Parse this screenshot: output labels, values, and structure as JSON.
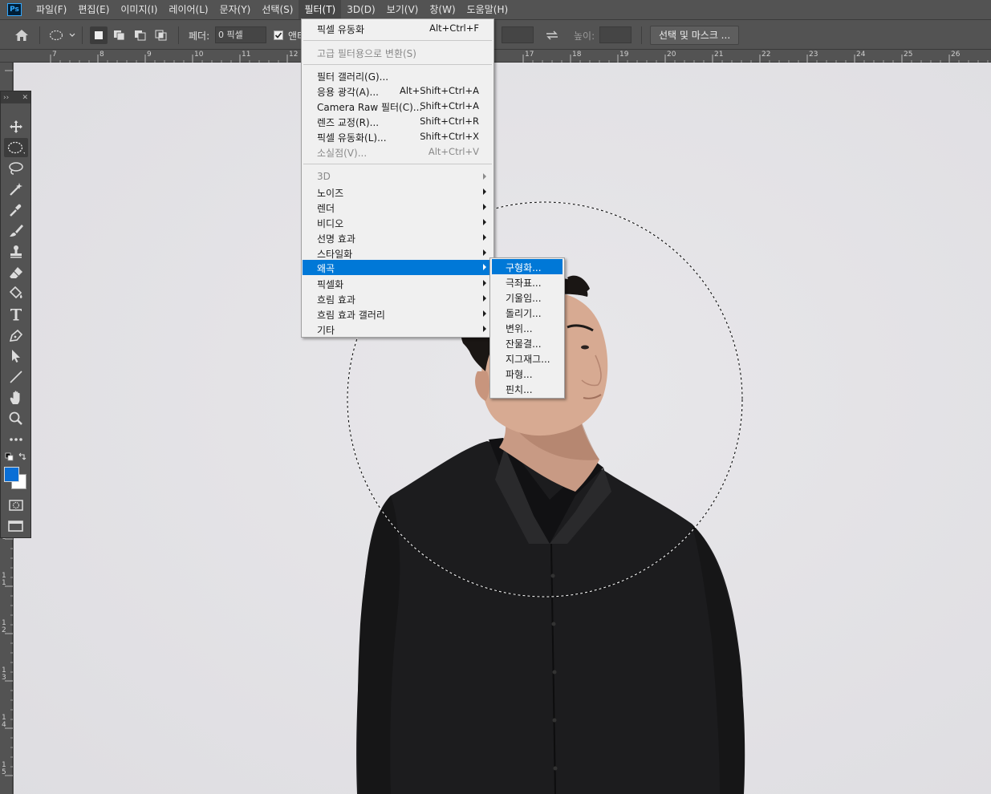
{
  "app": {
    "logo_text": "Ps"
  },
  "menubar": {
    "items": [
      "파일(F)",
      "편집(E)",
      "이미지(I)",
      "레이어(L)",
      "문자(Y)",
      "선택(S)",
      "필터(T)",
      "3D(D)",
      "보기(V)",
      "창(W)",
      "도움말(H)"
    ],
    "active": "필터(T)"
  },
  "options": {
    "feather_label": "페더:",
    "feather_value": "0 픽셀",
    "antialias_label": "앤티",
    "height_label": "높이:",
    "select_mask_label": "선택 및 마스크 ..."
  },
  "ruler": {
    "top_ticks": [
      "7",
      "8",
      "9",
      "10",
      "11",
      "12",
      "17",
      "18",
      "19",
      "20",
      "21",
      "22",
      "23",
      "24",
      "25",
      "26"
    ],
    "left_ticks": [
      "0",
      "1 1",
      "1 2",
      "1 3",
      "1 4",
      "1 5"
    ]
  },
  "filter_menu": {
    "top_items": [
      {
        "label": "픽셀 유동화",
        "shortcut": "Alt+Ctrl+F"
      }
    ],
    "convert_item": {
      "label": "고급 필터용으로 변환(S)"
    },
    "filter_items": [
      {
        "label": "필터 갤러리(G)...",
        "shortcut": ""
      },
      {
        "label": "응용 광각(A)...",
        "shortcut": "Alt+Shift+Ctrl+A"
      },
      {
        "label": "Camera Raw 필터(C)...",
        "shortcut": "Shift+Ctrl+A"
      },
      {
        "label": "렌즈 교정(R)...",
        "shortcut": "Shift+Ctrl+R"
      },
      {
        "label": "픽셀 유동화(L)...",
        "shortcut": "Shift+Ctrl+X"
      },
      {
        "label": "소실점(V)...",
        "shortcut": "Alt+Ctrl+V"
      }
    ],
    "submenus": [
      "3D",
      "노이즈",
      "렌더",
      "비디오",
      "선명 효과",
      "스타일화",
      "왜곡",
      "픽셀화",
      "흐림 효과",
      "흐림 효과 갤러리",
      "기타"
    ],
    "highlighted": "왜곡"
  },
  "distort_menu": {
    "items": [
      "구형화...",
      "극좌표...",
      "기울임...",
      "돌리기...",
      "변위...",
      "잔물결...",
      "지그재그...",
      "파형...",
      "핀치..."
    ],
    "highlighted": "구형화..."
  },
  "colors": {
    "foreground": "#0a6fd6",
    "background": "#ffffff",
    "highlight": "#0078d7"
  },
  "toolbar": {
    "tools": [
      "move-icon",
      "elliptical-marquee-icon",
      "lasso-icon",
      "magic-wand-icon",
      "eyedropper-icon",
      "brush-icon",
      "stamp-icon",
      "eraser-icon",
      "paint-bucket-icon",
      "type-icon",
      "pen-icon",
      "path-selection-icon",
      "line-icon",
      "hand-icon",
      "zoom-icon",
      "more-icon"
    ],
    "selected": "elliptical-marquee-icon"
  }
}
